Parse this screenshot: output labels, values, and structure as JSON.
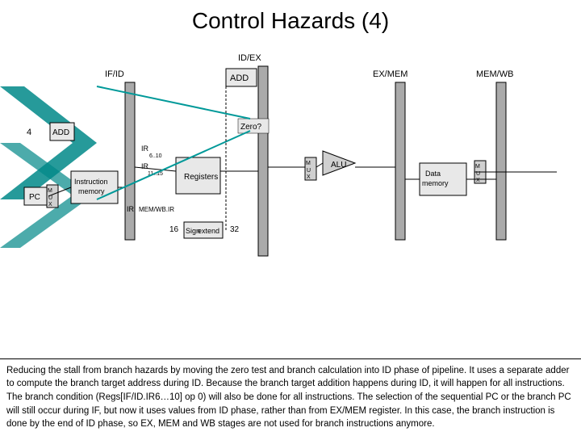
{
  "title": "Control Hazards (4)",
  "description_paragraphs": [
    "Reducing the stall from branch hazards by moving the zero test and branch calculation into ID phase of pipeline. It uses a separate adder to compute the branch target address during ID. Because the branch target addition happens during ID, it will happen for all instructions. The branch condition (Regs[IF/ID.IR6…10] op 0) will also be done for all instructions. The selection of the sequential PC or the branch PC will still occur during IF, but now it uses values from ID phase, rather than from EX/MEM register. In this case, the branch instruction is done by the end of ID phase, so EX, MEM and WB stages are not used for branch instructions anymore."
  ],
  "colors": {
    "teal": "#009999",
    "text": "#000000",
    "box_fill": "#d0d0d0",
    "pipeline_stage": "#b0b0b0"
  }
}
